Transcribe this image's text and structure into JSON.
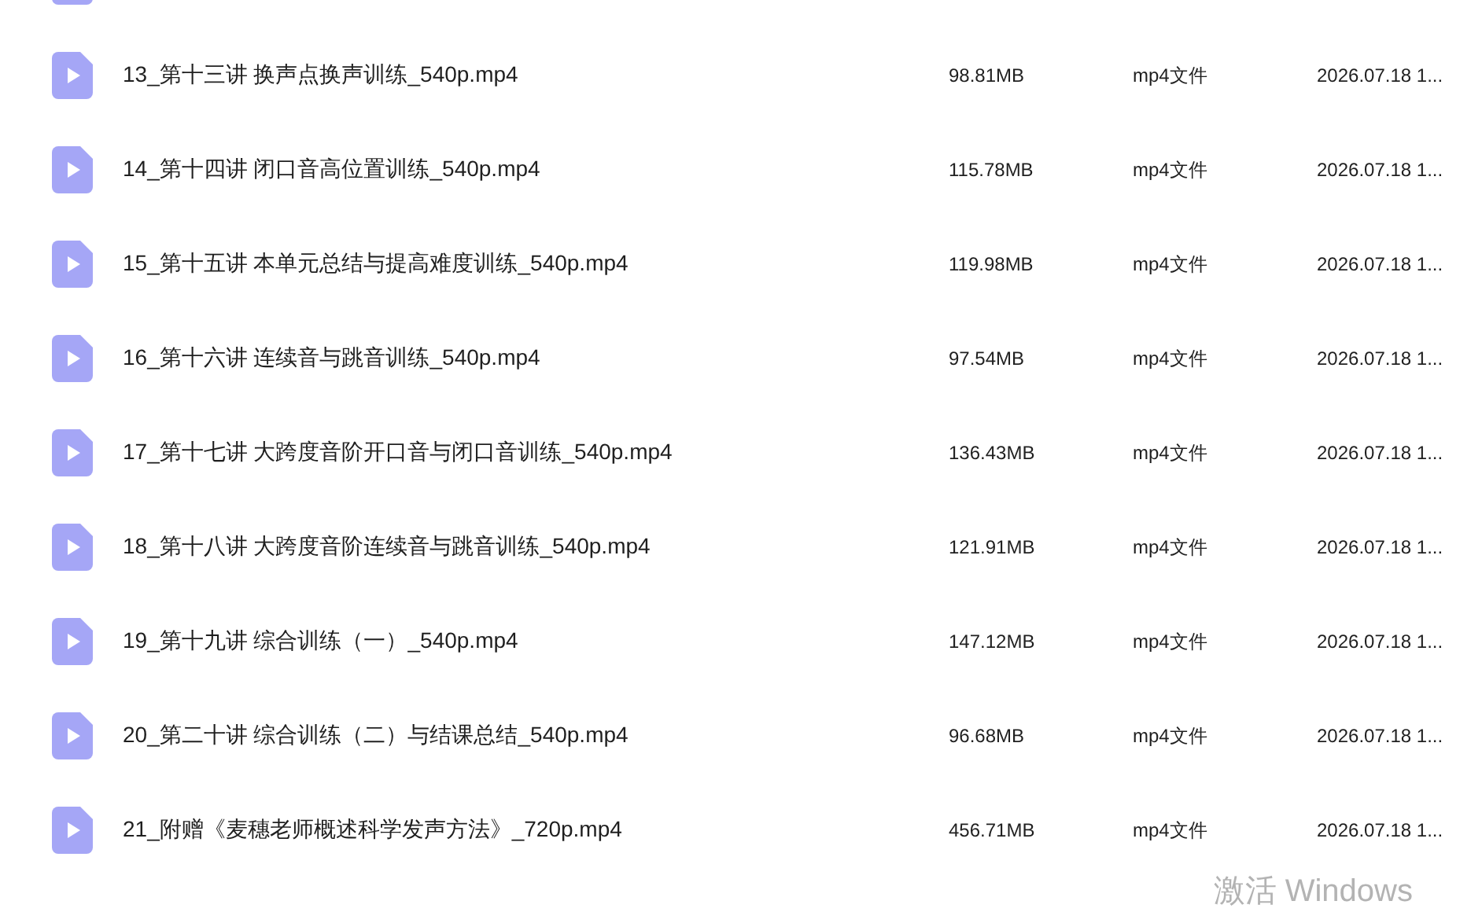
{
  "files": [
    {
      "name": "13_第十三讲 换声点换声训练_540p.mp4",
      "size": "98.81MB",
      "type": "mp4文件",
      "date": "2026.07.18 1..."
    },
    {
      "name": "14_第十四讲 闭口音高位置训练_540p.mp4",
      "size": "115.78MB",
      "type": "mp4文件",
      "date": "2026.07.18 1..."
    },
    {
      "name": "15_第十五讲 本单元总结与提高难度训练_540p.mp4",
      "size": "119.98MB",
      "type": "mp4文件",
      "date": "2026.07.18 1..."
    },
    {
      "name": "16_第十六讲 连续音与跳音训练_540p.mp4",
      "size": "97.54MB",
      "type": "mp4文件",
      "date": "2026.07.18 1..."
    },
    {
      "name": "17_第十七讲 大跨度音阶开口音与闭口音训练_540p.mp4",
      "size": "136.43MB",
      "type": "mp4文件",
      "date": "2026.07.18 1..."
    },
    {
      "name": "18_第十八讲 大跨度音阶连续音与跳音训练_540p.mp4",
      "size": "121.91MB",
      "type": "mp4文件",
      "date": "2026.07.18 1..."
    },
    {
      "name": "19_第十九讲 综合训练（一）_540p.mp4",
      "size": "147.12MB",
      "type": "mp4文件",
      "date": "2026.07.18 1..."
    },
    {
      "name": "20_第二十讲 综合训练（二）与结课总结_540p.mp4",
      "size": "96.68MB",
      "type": "mp4文件",
      "date": "2026.07.18 1..."
    },
    {
      "name": "21_附赠《麦穗老师概述科学发声方法》_720p.mp4",
      "size": "456.71MB",
      "type": "mp4文件",
      "date": "2026.07.18 1..."
    }
  ],
  "watermark": "激活 Windows"
}
